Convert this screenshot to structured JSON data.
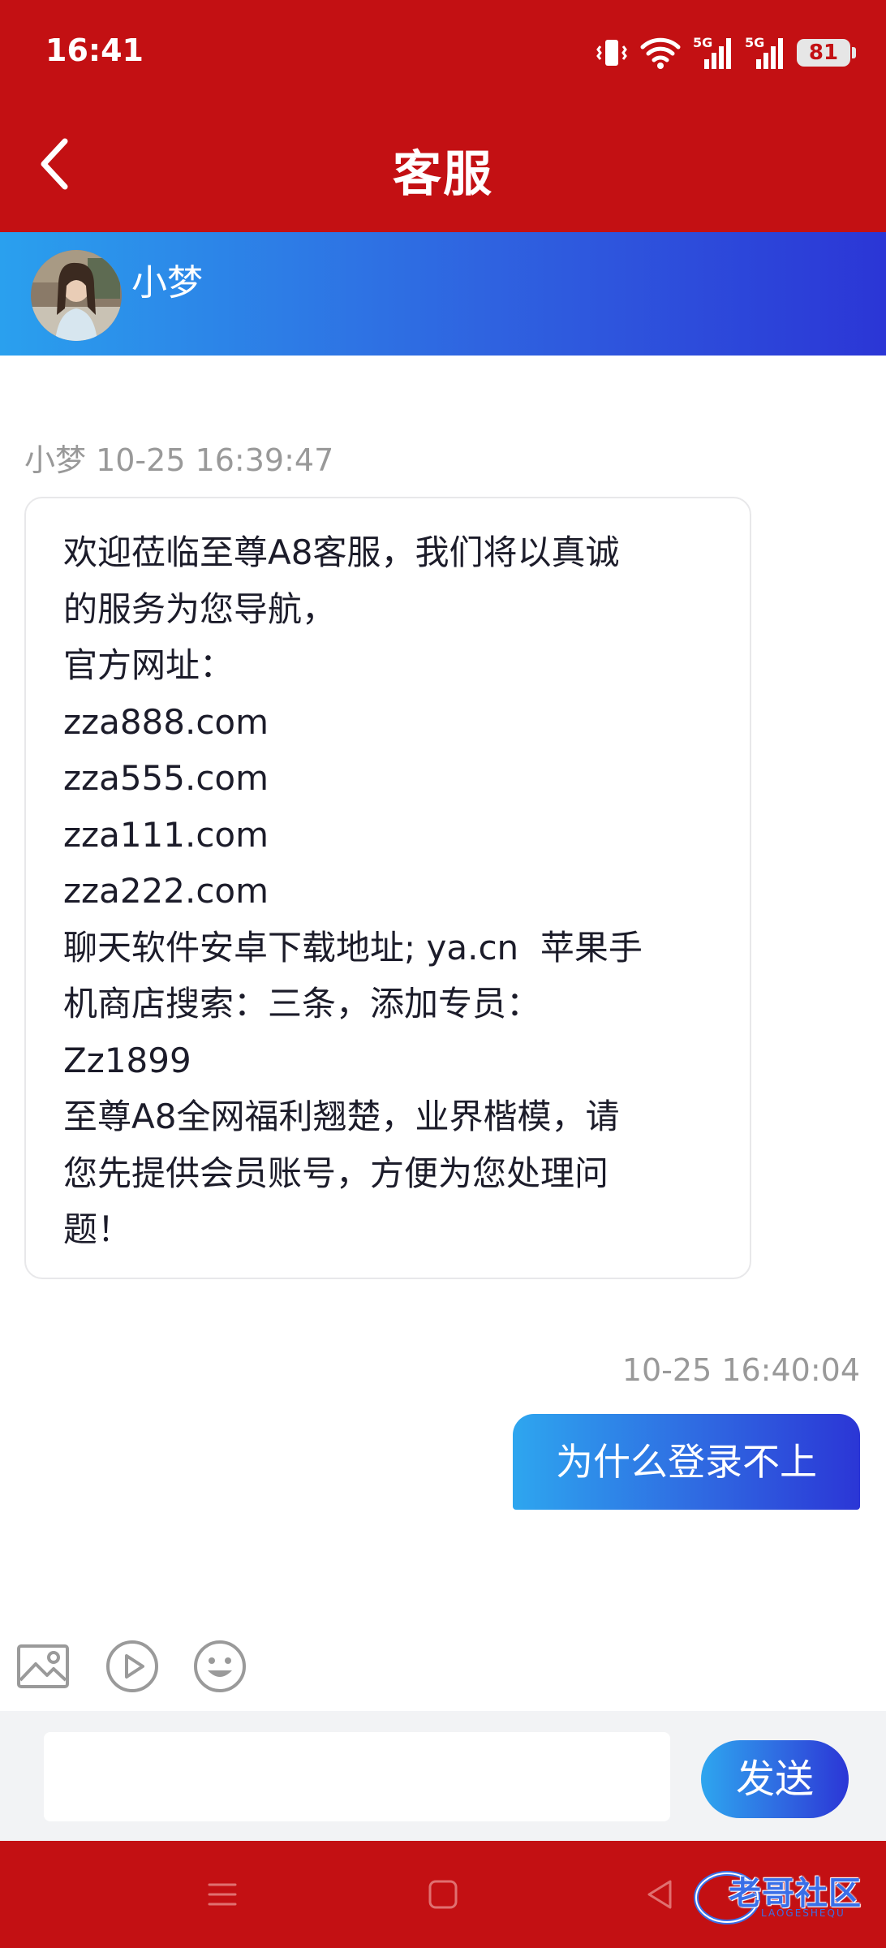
{
  "status_bar": {
    "time": "16:41",
    "battery": "81",
    "network_labels": [
      "5G",
      "5G"
    ],
    "icons": [
      "vibrate-icon",
      "wifi-icon",
      "signal-5g-icon",
      "signal-5g-icon",
      "battery-icon"
    ]
  },
  "header": {
    "title": "客服",
    "back_icon": "chevron-left-icon"
  },
  "agent": {
    "name": "小梦"
  },
  "messages": [
    {
      "side": "left",
      "meta": "小梦 10-25 16:39:47",
      "text": "欢迎莅临至尊A8客服，我们将以真诚\n的服务为您导航，\n官方网址：\nzza888.com\nzza555.com\nzza111.com\nzza222.com\n聊天软件安卓下载地址; ya.cn  苹果手\n机商店搜索：三条，添加专员：\nZz1899\n至尊A8全网福利翘楚，业界楷模，请\n您先提供会员账号，方便为您处理问\n题！"
    },
    {
      "side": "right",
      "meta": "10-25 16:40:04",
      "text": "为什么登录不上"
    }
  ],
  "toolbar": {
    "icons": [
      "image-icon",
      "video-icon",
      "emoji-icon"
    ]
  },
  "composer": {
    "value": "",
    "placeholder": "",
    "send_label": "发送"
  },
  "nav": {
    "icons": [
      "menu-icon",
      "home-icon",
      "back-triangle-icon"
    ]
  },
  "watermark": {
    "text": "老哥社区",
    "subtext": "LAOGESHEQU"
  },
  "colors": {
    "brand_red": "#c31013",
    "gradient_start": "#2aa0ee",
    "gradient_end": "#2b36d6"
  }
}
